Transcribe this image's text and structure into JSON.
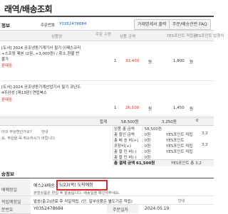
{
  "page": {
    "title": "래역/배송조회",
    "tabs": [
      "거래명세서 출력",
      "주문/배송관련 FAQ"
    ]
  },
  "order_section": {
    "label": "정보",
    "order_no_label": "주문번호",
    "order_no": "Y0352478684"
  },
  "items_table": {
    "headers": [
      "상품명",
      "주문 수량",
      "상품 금액",
      "YES포인트 적립금",
      "YES포인트 발행처"
    ],
    "rows": [
      {
        "name_line1": "[도서] 2024 공조냉동기계기사 필기 이패스코리",
        "name_line2": "+스프링 제본 (2권, +3,000원) / 취소,환불 반",
        "name_line3": "불가",
        "status": "판매중",
        "qty": "1",
        "price": "32,400",
        "price_unit": "원",
        "point": "1,800",
        "point_unit": "원"
      },
      {
        "name_line1": "[도서] 2024 공조냉동기계산업기사 필기 과년도",
        "name_line2": "4주완성 [제13판] 연립북스",
        "status": "판매중",
        "qty": "1",
        "price": "26,100",
        "price_unit": "원",
        "point": "1,450",
        "point_unit": "원"
      }
    ],
    "total_row": {
      "label": "합계",
      "price": "58,500원",
      "point": "3,250원",
      "point_count": "0"
    }
  },
  "summary": {
    "lines": [
      {
        "label": "상품 총 금액",
        "value": ": 58,500원"
      },
      {
        "label": "총 할인 금액",
        "value": ": 0원"
      },
      {
        "label": "총 배 송 비(+)",
        "value": ": 0원"
      },
      {
        "label": "포장비(+)",
        "value": ": 0원"
      },
      {
        "label": "총 할 인 비(-)",
        "value": ": 0원"
      },
      {
        "label": "총 할 인 비(-)",
        "value": ": 0원"
      }
    ],
    "right_labels": [
      "YES포인트 적립",
      "YES포인트",
      "YES포인트 적립",
      "YES포인트 적립"
    ],
    "right_values": [
      "3,2",
      "",
      "3,2",
      ""
    ],
    "final_label": "총 결제 금액 61,500원",
    "final_right": "YES포인트 총 3,2"
  },
  "notice": {
    "line1": "이의 무상환인가요?",
    "line1_tail": "안내",
    "line2": "요. 주문을 꼭 취소하시기 바랍니다."
  },
  "shipping_section": {
    "label": "송정보",
    "row1_label": "배예정일",
    "delivery_method": "예스24배송",
    "delivery_date": "5/23(목) 도착예정",
    "row1_note": "분할상품은 편집 후 발송됩니다. 배송일을 확인하주세요.",
    "row2_label": "적립예정일",
    "row2_value": "발송(출고)완료 후 익일적립. (단, 일부상품은 별도기준 적립)",
    "row2_tail": "안내",
    "row3_label": "문번호",
    "row3_value": "Y0352478684",
    "row3_mid_label": "주문일자",
    "row3_mid_value": "2024.05.19"
  },
  "colors": {
    "accent_red": "#e02a2a",
    "accent_blue": "#1a5fb4",
    "highlight_border": "#d92b2b"
  }
}
